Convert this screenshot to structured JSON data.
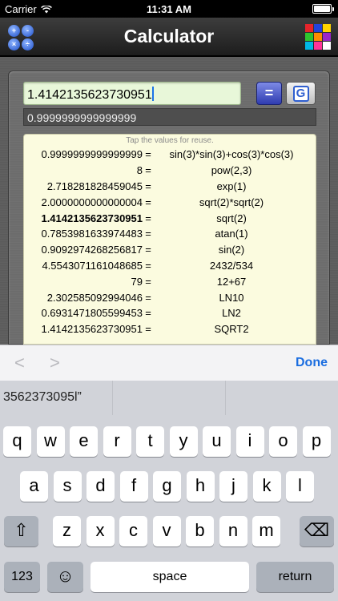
{
  "status": {
    "carrier": "Carrier",
    "time": "11:31 AM"
  },
  "nav": {
    "title": "Calculator",
    "ops_symbols": [
      "+",
      "-",
      "×",
      "÷"
    ],
    "palette_colors": [
      "#e6242b",
      "#2244dd",
      "#ffd400",
      "#2ec42e",
      "#ff8c00",
      "#9b26c9",
      "#00b7e6",
      "#ff3399",
      "#ffffff"
    ]
  },
  "input": {
    "expression": "1.4142135623730951",
    "equals_label": "=",
    "g_label": "G"
  },
  "result": "0.9999999999999999",
  "history": {
    "hint": "Tap the values for reuse.",
    "rows": [
      {
        "value": "0.9999999999999999",
        "expr": "sin(3)*sin(3)+cos(3)*cos(3)"
      },
      {
        "value": "8",
        "expr": "pow(2,3)"
      },
      {
        "value": "2.718281828459045",
        "expr": "exp(1)"
      },
      {
        "value": "2.0000000000000004",
        "expr": "sqrt(2)*sqrt(2)"
      },
      {
        "value": "1.4142135623730951",
        "expr": "sqrt(2)",
        "bold": true
      },
      {
        "value": "0.7853981633974483",
        "expr": "atan(1)"
      },
      {
        "value": "0.9092974268256817",
        "expr": "sin(2)"
      },
      {
        "value": "4.5543071161048685",
        "expr": "2432/534"
      },
      {
        "value": "79",
        "expr": "12+67"
      },
      {
        "value": "2.302585092994046",
        "expr": "LN10"
      },
      {
        "value": "0.6931471805599453",
        "expr": "LN2"
      },
      {
        "value": "1.4142135623730951",
        "expr": "SQRT2"
      }
    ]
  },
  "accessory": {
    "prev": "<",
    "next": ">",
    "done": "Done"
  },
  "predictive": [
    "3562373095l”",
    "",
    ""
  ],
  "keyboard": {
    "row1": [
      "q",
      "w",
      "e",
      "r",
      "t",
      "y",
      "u",
      "i",
      "o",
      "p"
    ],
    "row2": [
      "a",
      "s",
      "d",
      "f",
      "g",
      "h",
      "j",
      "k",
      "l"
    ],
    "row3": [
      "z",
      "x",
      "c",
      "v",
      "b",
      "n",
      "m"
    ],
    "shift": "⇧",
    "delete": "⌫",
    "numbers": "123",
    "emoji": "☺",
    "space": "space",
    "return": "return"
  }
}
